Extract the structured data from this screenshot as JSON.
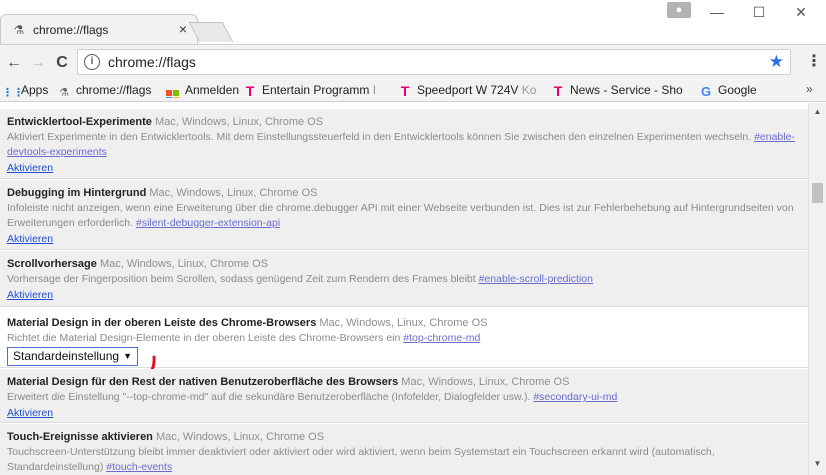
{
  "tab": {
    "icon": "flask-icon",
    "title": "chrome://flags",
    "close": "×"
  },
  "window_controls": {
    "profile_icon": "person-icon",
    "minimize": "—",
    "maximize": "☐",
    "close": "✕"
  },
  "toolbar": {
    "back": "←",
    "forward": "→",
    "reload": "C",
    "url_prefix": "chrome://",
    "url_host": "flags",
    "info_icon": "info-icon",
    "star_icon": "star-icon",
    "star_color": "#2a6ee8",
    "menu": "⋮"
  },
  "bookmarks": {
    "items": [
      {
        "label": "Apps",
        "icon": "apps-grid-icon"
      },
      {
        "label": "chrome://flags",
        "icon": "flask-icon"
      },
      {
        "label": "Anmelden",
        "icon": "microsoft-logo-icon"
      },
      {
        "label": "Entertain Programm",
        "faded": "I",
        "icon": "telekom-t-icon"
      },
      {
        "label": "Speedport W 724V",
        "faded": "Ko",
        "icon": "telekom-t-icon"
      },
      {
        "label": "News - Service - Shop",
        "icon": "telekom-t-icon"
      },
      {
        "label": "Google",
        "icon": "google-g-icon"
      }
    ],
    "more": "»",
    "telekom_color": "#e20074"
  },
  "flags": [
    {
      "name": "Entwicklertool-Experimente",
      "platforms": "Mac, Windows, Linux, Chrome OS",
      "desc_lines": [
        "Aktiviert Experimente in den Entwicklertools. Mit dem Einstellungssteuerfeld in den Entwicklertools können Sie zwischen den einzelnen Experimenten wechseln. ",
        ""
      ],
      "hash_part1": "#enable-",
      "hash_part2": "devtools-experiments",
      "action": "Aktivieren"
    },
    {
      "name": "Debugging im Hintergrund",
      "platforms": "Mac, Windows, Linux, Chrome OS",
      "desc_line1": "Infoleiste nicht anzeigen, wenn eine Erweiterung über die chrome.debugger API mit einer Webseite verbunden ist. Dies ist zur Fehlerbehebung auf Hintergrundseiten von",
      "desc_line2": "Erweiterungen erforderlich. ",
      "hash": "#silent-debugger-extension-api",
      "action": "Aktivieren"
    },
    {
      "name": "Scrollvorhersage",
      "platforms": "Mac, Windows, Linux, Chrome OS",
      "desc_line1": "Vorhersage der Fingerposition beim Scrollen, sodass genügend Zeit zum Rendern des Frames bleibt ",
      "hash": "#enable-scroll-prediction",
      "action": "Aktivieren"
    },
    {
      "name": "Material Design in der oberen Leiste des Chrome-Browsers",
      "platforms": "Mac, Windows, Linux, Chrome OS",
      "desc_line1": "Richtet die Material Design-Elemente in der oberen Leiste des Chrome-Browsers ein ",
      "hash": "#top-chrome-md",
      "select_value": "Standardeinstellung",
      "select_caret": "▼",
      "annotation_color": "#e0141e"
    },
    {
      "name": "Material Design für den Rest der nativen Benutzeroberfläche des Browsers",
      "platforms": "Mac, Windows, Linux, Chrome OS",
      "desc_line1": "Erweitert die Einstellung \"--top-chrome-md\" auf die sekundäre Benutzeroberfläche (Infofelder, Dialogfelder usw.). ",
      "hash": "#secondary-ui-md",
      "action": "Aktivieren"
    },
    {
      "name": "Touch-Ereignisse aktivieren",
      "platforms": "Mac, Windows, Linux, Chrome OS",
      "desc_line1": "Touchscreen-Unterstützung bleibt immer deaktiviert oder aktiviert oder wird aktiviert, wenn beim Systemstart ein Touchscreen erkannt wird (automatisch,",
      "desc_line2": "Standardeinstellung) ",
      "hash": "#touch-events"
    }
  ],
  "scrollbar": {
    "up": "▲",
    "down": "▼"
  }
}
